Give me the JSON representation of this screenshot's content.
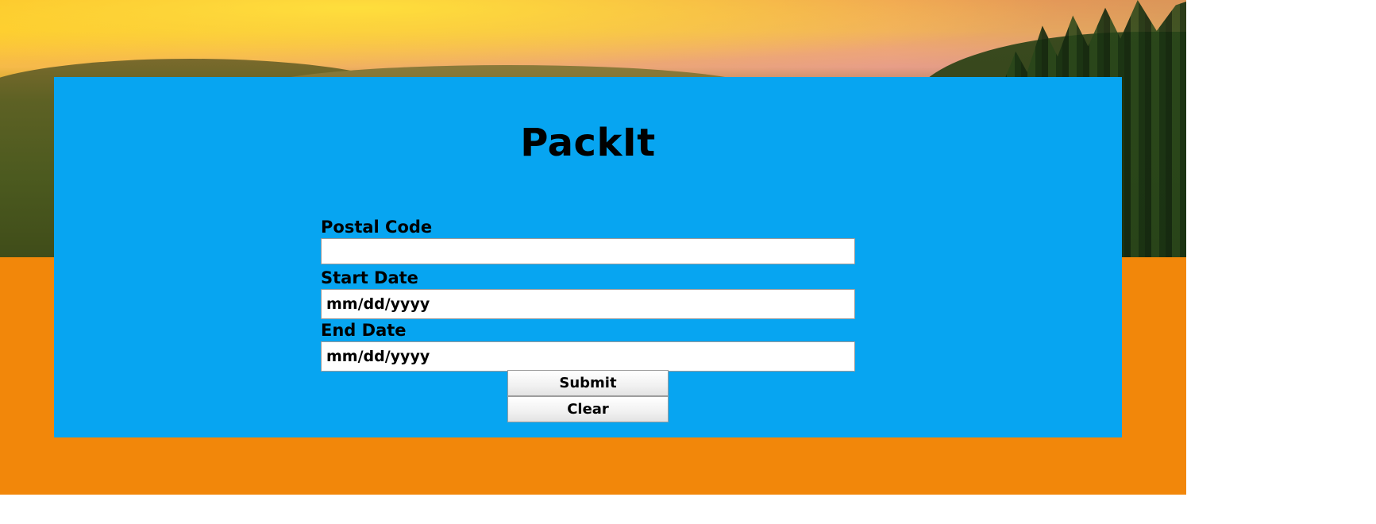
{
  "app": {
    "title": "PackIt"
  },
  "form": {
    "postal_code_label": "Postal Code",
    "postal_code_value": "",
    "start_date_label": "Start Date",
    "start_date_value": "mm/dd/yyyy",
    "end_date_label": "End Date",
    "end_date_value": "mm/dd/yyyy"
  },
  "buttons": {
    "submit_label": "Submit",
    "clear_label": "Clear"
  },
  "colors": {
    "panel": "#07a5f1",
    "band": "#f2870a",
    "page": "#ffffff"
  }
}
